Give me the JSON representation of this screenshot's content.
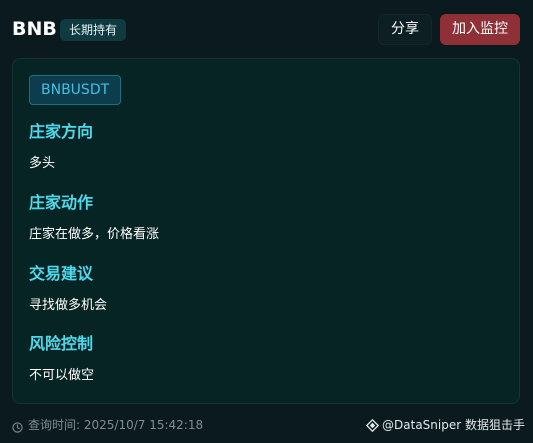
{
  "header": {
    "title": "BNB",
    "tag": "长期持有",
    "share_label": "分享",
    "monitor_label": "加入监控"
  },
  "card": {
    "symbol": "BNBUSDT",
    "sections": [
      {
        "heading": "庄家方向",
        "text": "多头"
      },
      {
        "heading": "庄家动作",
        "text": "庄家在做多，价格看涨"
      },
      {
        "heading": "交易建议",
        "text": "寻找做多机会"
      },
      {
        "heading": "风险控制",
        "text": "不可以做空"
      }
    ]
  },
  "footer": {
    "query_time": "查询时间: 2025/10/7 15:42:18",
    "brand": "@DataSniper 数据狙击手",
    "icons": [
      "clock-icon",
      "datasniper-logo-icon"
    ]
  },
  "colors": {
    "background": "#0b1a1f",
    "card": "#062423",
    "accent": "#4fd9ec",
    "monitor_button": "#8e3036",
    "symbol_badge": "#0d3c4c"
  }
}
